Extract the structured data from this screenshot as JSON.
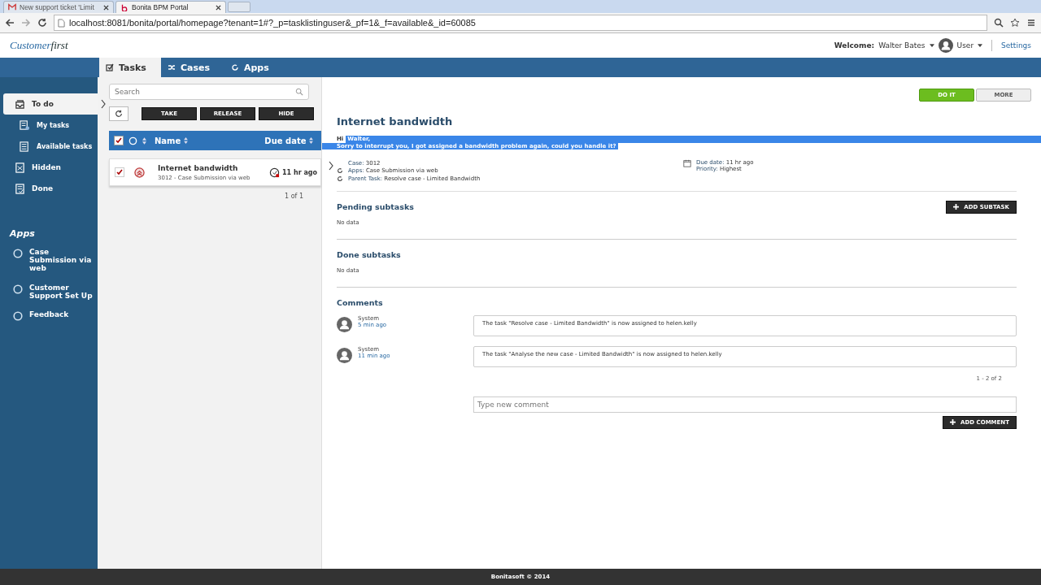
{
  "browser": {
    "tabs": [
      {
        "label": "New support ticket 'Limit",
        "kind": "mail",
        "selected": false
      },
      {
        "label": "Bonita BPM Portal",
        "kind": "bonita",
        "selected": true
      }
    ],
    "url": "localhost:8081/bonita/portal/homepage?tenant=1#?_p=tasklistinguser&_pf=1&_f=available&_id=60085"
  },
  "header": {
    "logo": {
      "part_1": "Customer",
      "part_2": "first"
    },
    "welcome_label": "Welcome:",
    "user_name": "Walter Bates",
    "profile": "User",
    "settings": "Settings"
  },
  "nav_tabs": [
    {
      "label": "Tasks",
      "kind": "tasks",
      "selected": true
    },
    {
      "label": "Cases",
      "kind": "cases",
      "selected": false
    },
    {
      "label": "Apps",
      "kind": "apps",
      "selected": false
    }
  ],
  "sidebar": {
    "items": [
      {
        "label": "To do",
        "kind": "todo",
        "selected": true,
        "children": [
          {
            "label": "My tasks",
            "kind": "mytasks",
            "selected": false
          },
          {
            "label": "Available tasks",
            "kind": "available",
            "selected": false
          }
        ]
      },
      {
        "label": "Hidden",
        "kind": "hidden",
        "selected": false
      },
      {
        "label": "Done",
        "kind": "done",
        "selected": false
      }
    ],
    "apps_heading": "Apps",
    "apps": [
      "Case Submission via web",
      "Customer Support Set Up",
      "Feedback"
    ]
  },
  "task_list": {
    "search": {
      "placeholder": "Search"
    },
    "actions": [
      "TAKE",
      "RELEASE",
      "HIDE"
    ],
    "header": {
      "all_checked": true,
      "name": "Name",
      "due_date": "Due date"
    },
    "rows": [
      {
        "checked": true,
        "name": "Internet bandwidth",
        "subtitle": "3012 - Case Submission via web",
        "due": "11 hr ago"
      }
    ],
    "pager": "1 of 1"
  },
  "detail": {
    "buttons": [
      {
        "label": "DO IT",
        "kind": "primary"
      },
      {
        "label": "MORE",
        "kind": "secondary"
      }
    ],
    "title": "Internet bandwidth",
    "message": {
      "greeting_prefix": "Hi",
      "greeting": "Walter,",
      "body": "Sorry to interrupt you, I got assigned a bandwidth problem again, could you handle it?",
      "selected": true
    },
    "meta_left": [
      {
        "label": "Case:",
        "value": "3012"
      },
      {
        "label": "Apps:",
        "value": "Case Submission via web"
      },
      {
        "label": "Parent Task:",
        "value": "Resolve case - Limited Bandwidth"
      }
    ],
    "meta_right": [
      {
        "label": "Due date:",
        "value": "11 hr ago"
      },
      {
        "label": "Priority:",
        "value": "Highest"
      }
    ],
    "pending": {
      "title": "Pending subtasks",
      "button": "ADD SUBTASK",
      "empty": "No data"
    },
    "done": {
      "title": "Done subtasks",
      "empty": "No data"
    },
    "comments": {
      "title": "Comments",
      "items": [
        {
          "author": "System",
          "time": "5 min ago",
          "text": "The task \"Resolve case - Limited Bandwidth\" is now assigned to helen.kelly"
        },
        {
          "author": "System",
          "time": "11 min ago",
          "text": "The task \"Analyse the new case - Limited Bandwidth\" is now assigned to helen.kelly"
        }
      ],
      "pager": "1 - 2 of 2",
      "placeholder": "Type new comment",
      "button": "ADD COMMENT"
    }
  },
  "footer": "Bonitasoft © 2014"
}
